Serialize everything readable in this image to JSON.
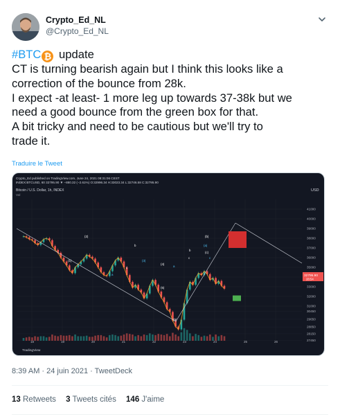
{
  "author": {
    "display_name": "Crypto_Ed_NL",
    "handle": "@Crypto_Ed_NL"
  },
  "tweet": {
    "hashtag": "#BTC",
    "emoji": "₿",
    "title_word": "update",
    "lines": [
      "CT is turning bearish again but I think this looks like a",
      "correction of the bounce from 28k.",
      "I expect -at least- 1 more leg up towards 37-38k but we",
      "need a good bounce from the green box for that.",
      "A bit tricky and need to be cautious but we'll try to",
      "trade it."
    ],
    "translate_link": "Traduire le Tweet",
    "timestamp": "8:39 AM · 24 juin 2021 · TweetDeck"
  },
  "stats": {
    "retweets_count": "13",
    "retweets_label": "Retweets",
    "quotes_count": "3",
    "quotes_label": "Tweets cités",
    "likes_count": "146",
    "likes_label": "J'aime"
  },
  "chart": {
    "publisher_line": "Crypto_Ed published on TradingView.com, June 24, 2021 08:31:06 CEST",
    "ohlc_line": "INDEX:BTCUSD, 60  32795.90 ▼ −880.32 (−2.61%)  O:32996.34  H:33023.34  L:32746.58  C:32795.90",
    "legend_title": "Bitcoin / U.S. Dollar, 1h, INDEX",
    "legend_sub": "Vol",
    "currency": "USD",
    "price_tag": "32795.90",
    "price_tag_time": "28:54",
    "logo_text": "TradingView",
    "up_color": "#26a69a",
    "down_color": "#ef5350",
    "wave_color": "#f5a623",
    "target_box_color": "#d32f2f",
    "support_box_color": "#4caf50",
    "wave_labels": [
      "(1)",
      "(2)",
      "a",
      "b",
      "c",
      "(3)",
      "(4)",
      "(5)",
      "a",
      "b",
      "c",
      "(a)",
      "(b)",
      "(c)",
      "c",
      "(5)"
    ]
  },
  "chart_data": {
    "type": "line",
    "title": "Bitcoin / U.S. Dollar, 1h, INDEX",
    "x_ticks": [
      "18",
      "19",
      "20",
      "21",
      "22",
      "23",
      "24",
      "25",
      "26"
    ],
    "y_ticks": [
      41000,
      40000,
      39000,
      38000,
      37000,
      36000,
      35000,
      34000,
      33000,
      32000,
      31000,
      30450,
      29650,
      28850,
      28150,
      27450
    ],
    "ylim": [
      27000,
      42000
    ],
    "series": [
      {
        "values": [
          38200,
          38100,
          37900,
          37800,
          37500,
          37300,
          37600,
          37900,
          38000,
          37800,
          37200,
          36800,
          36500,
          36000,
          35600,
          35200,
          34700,
          34400,
          35000,
          35300,
          35600,
          35900,
          36300,
          36100,
          35900,
          35500,
          35000,
          34500,
          34200,
          34100,
          34600,
          35200,
          35700,
          36000,
          35600,
          35000,
          34200,
          33500,
          32900,
          33200,
          32700,
          32400,
          31800,
          32300,
          33100,
          33700,
          33200,
          32500,
          31900,
          31400,
          30700,
          30400,
          29500,
          28900,
          28600,
          29600,
          31300,
          32700,
          33500,
          33200,
          33900,
          34400,
          34200,
          34600,
          34300,
          33700,
          33900,
          33300,
          33600,
          33100,
          32800
        ]
      }
    ],
    "wave_count_annotations": {
      "target_box": [
        37000,
        38000
      ],
      "support_box": [
        31700,
        32100
      ]
    }
  }
}
